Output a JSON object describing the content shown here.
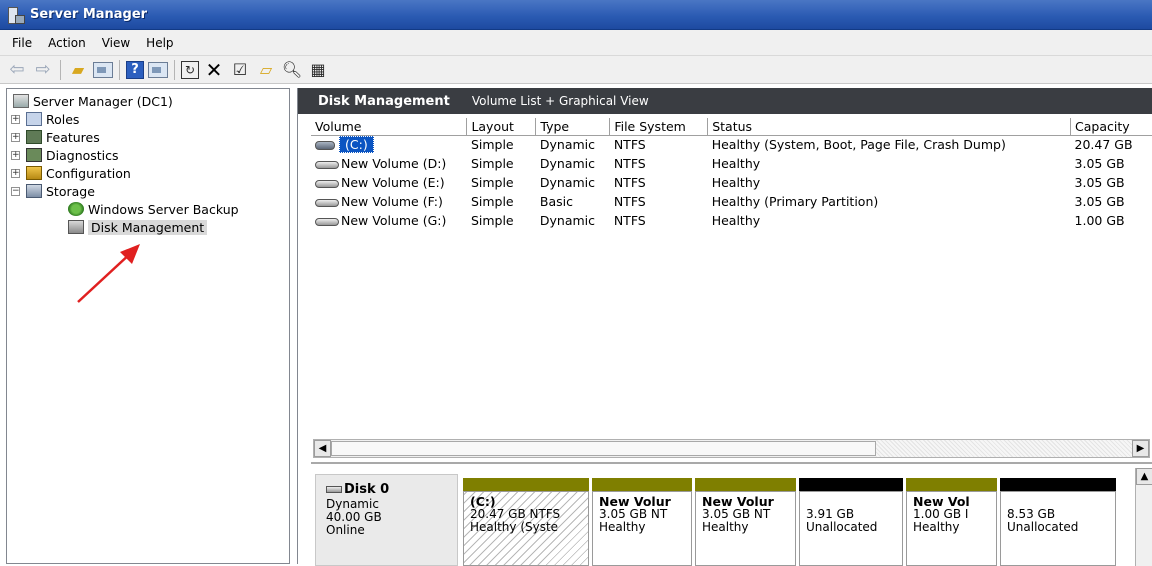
{
  "window": {
    "title": "Server Manager"
  },
  "menu": [
    "File",
    "Action",
    "View",
    "Help"
  ],
  "toolbar": {
    "icons": [
      "back-arrow-icon",
      "forward-arrow-icon",
      "up-folder-icon",
      "show-hide-tree-icon",
      "help-icon",
      "action-pane-icon",
      "refresh-icon",
      "delete-icon",
      "properties-icon",
      "open-icon",
      "search-icon",
      "settings-icon"
    ]
  },
  "tree": {
    "root": "Server Manager (DC1)",
    "items": [
      "Roles",
      "Features",
      "Diagnostics",
      "Configuration",
      "Storage"
    ],
    "storage_children": [
      "Windows Server Backup",
      "Disk Management"
    ],
    "expander_plus": "+",
    "expander_minus": "−"
  },
  "pane": {
    "title": "Disk Management",
    "subtitle": "Volume List + Graphical View"
  },
  "volumes": {
    "columns": [
      "Volume",
      "Layout",
      "Type",
      "File System",
      "Status",
      "Capacity"
    ],
    "rows": [
      [
        "(C:)",
        "Simple",
        "Dynamic",
        "NTFS",
        "Healthy (System, Boot, Page File, Crash Dump)",
        "20.47 GB"
      ],
      [
        "New Volume (D:)",
        "Simple",
        "Dynamic",
        "NTFS",
        "Healthy",
        "3.05 GB"
      ],
      [
        "New Volume (E:)",
        "Simple",
        "Dynamic",
        "NTFS",
        "Healthy",
        "3.05 GB"
      ],
      [
        "New Volume (F:)",
        "Simple",
        "Basic",
        "NTFS",
        "Healthy (Primary Partition)",
        "3.05 GB"
      ],
      [
        "New Volume (G:)",
        "Simple",
        "Dynamic",
        "NTFS",
        "Healthy",
        "1.00 GB"
      ]
    ]
  },
  "disk": {
    "name": "Disk 0",
    "type": "Dynamic",
    "size": "40.00 GB",
    "status": "Online",
    "partitions": [
      {
        "name": "(C:)",
        "size": "20.47 GB NTFS",
        "status": "Healthy (Syste",
        "bar": "#7f7f00",
        "hatched": true
      },
      {
        "name": "New Volur",
        "size": "3.05 GB NT",
        "status": "Healthy",
        "bar": "#7f7f00",
        "hatched": false
      },
      {
        "name": "New Volur",
        "size": "3.05 GB NT",
        "status": "Healthy",
        "bar": "#7f7f00",
        "hatched": false
      },
      {
        "name": "",
        "size": "3.91 GB",
        "status": "Unallocated",
        "bar": "#000000",
        "hatched": false
      },
      {
        "name": "New Vol",
        "size": "1.00 GB I",
        "status": "Healthy",
        "bar": "#7f7f00",
        "hatched": false
      },
      {
        "name": "",
        "size": "8.53 GB",
        "status": "Unallocated",
        "bar": "#000000",
        "hatched": false
      }
    ]
  },
  "colors": {
    "header_bg": "#3a3d42",
    "dynamic_volume": "#7f7f00",
    "unallocated": "#000000",
    "selection": "#0a54c2",
    "annotation_arrow": "#e02020"
  }
}
